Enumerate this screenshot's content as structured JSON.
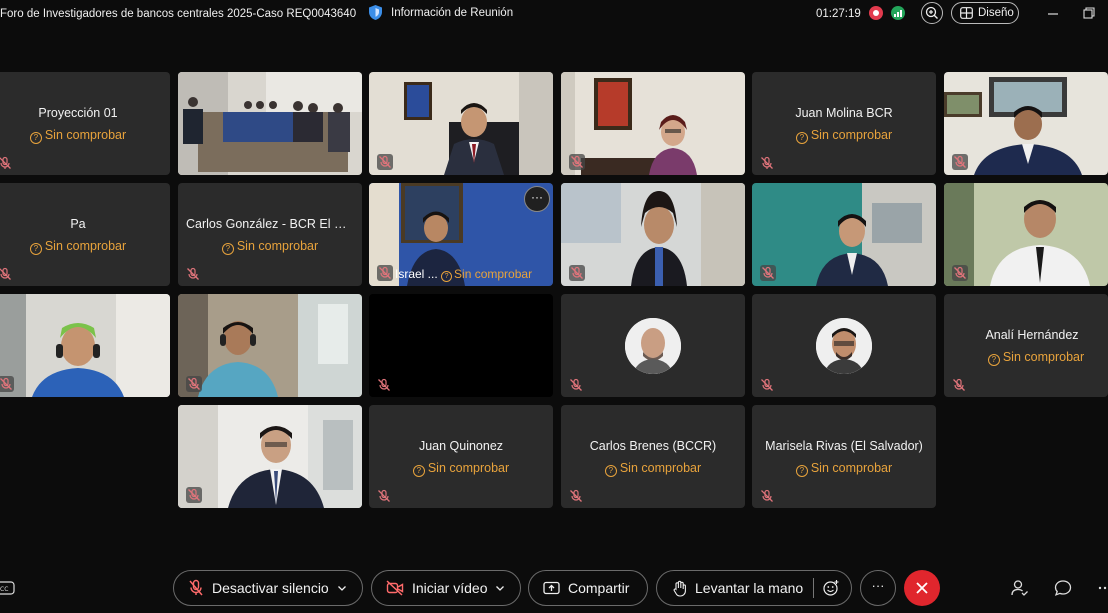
{
  "titlebar": {
    "meeting_title": "Foro de Investigadores de bancos centrales 2025-Caso REQ0043640",
    "info_label": "Información de Reunión",
    "timer": "01:27:19",
    "layout_label": "Diseño"
  },
  "status_text": "Sin comprobar",
  "tiles": {
    "proyeccion": "Proyección 01",
    "juan_molina": "Juan Molina BCR",
    "pa": "Pa",
    "carlos_gonzalez": "Carlos González - BCR El Salvador",
    "israel": "Israel ...",
    "anali": "Analí Hernández",
    "juan_quinonez": "Juan Quinonez",
    "carlos_brenes": "Carlos Brenes (BCCR)",
    "marisela": "Marisela Rivas (El Salvador)"
  },
  "toolbar": {
    "mute_label": "Desactivar silencio",
    "video_label": "Iniciar vídeo",
    "share_label": "Compartir",
    "raise_hand_label": "Levantar la mano",
    "more_label": "···"
  },
  "colors": {
    "status": "#e8a33c",
    "leave": "#e0262d",
    "tile_bg": "#2b2b2b"
  }
}
